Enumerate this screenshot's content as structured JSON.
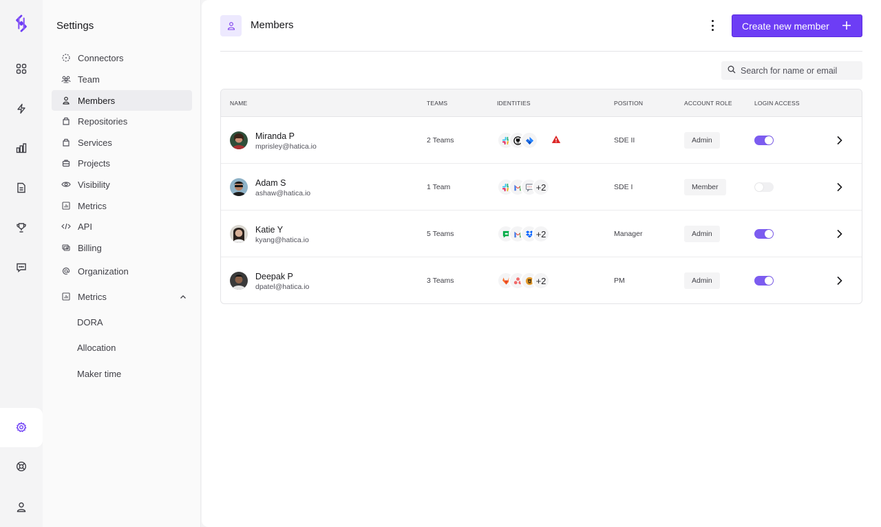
{
  "settings": {
    "title": "Settings",
    "nav": [
      {
        "label": "Connectors",
        "icon": "connectors-icon"
      },
      {
        "label": "Team",
        "icon": "team-icon"
      },
      {
        "label": "Members",
        "icon": "user-icon",
        "active": true
      },
      {
        "label": "Repositories",
        "icon": "repository-icon"
      },
      {
        "label": "Services",
        "icon": "services-icon"
      },
      {
        "label": "Projects",
        "icon": "briefcase-icon"
      },
      {
        "label": "Visibility",
        "icon": "eye-icon"
      },
      {
        "label": "Metrics",
        "icon": "metrics-icon"
      },
      {
        "label": "API",
        "icon": "code-icon"
      },
      {
        "label": "Billing",
        "icon": "billing-icon"
      },
      {
        "label": "Organization",
        "icon": "at-icon"
      },
      {
        "label": "Metrics",
        "icon": "metrics-icon",
        "expanded": true
      }
    ],
    "sub_nav": [
      "DORA",
      "Allocation",
      "Maker time"
    ]
  },
  "header": {
    "title": "Members",
    "create_label": "Create new member"
  },
  "search": {
    "placeholder": "Search for name or email"
  },
  "table": {
    "columns": [
      "NAME",
      "TEAMS",
      "IDENTITIES",
      "POSITION",
      "ACCOUNT ROLE",
      "LOGIN ACCESS"
    ],
    "rows": [
      {
        "name": "Miranda P",
        "email": "mprisley@hatica.io",
        "teams": "2 Teams",
        "identities": [
          "slack-icon",
          "github-icon",
          "jira-icon"
        ],
        "extra": "",
        "warning": true,
        "position": "SDE II",
        "role": "Admin",
        "login_access": true
      },
      {
        "name": "Adam S",
        "email": "ashaw@hatica.io",
        "teams": "1 Team",
        "identities": [
          "slack-icon",
          "gmail-icon",
          "chat-icon"
        ],
        "extra": "+2",
        "warning": false,
        "position": "SDE I",
        "role": "Member",
        "login_access": false
      },
      {
        "name": "Katie Y",
        "email": "kyang@hatica.io",
        "teams": "5 Teams",
        "identities": [
          "google-chat-icon",
          "gmail-icon",
          "dropbox-icon"
        ],
        "extra": "+2",
        "warning": false,
        "position": "Manager",
        "role": "Admin",
        "login_access": true
      },
      {
        "name": "Deepak P",
        "email": "dpatel@hatica.io",
        "teams": "3 Teams",
        "identities": [
          "gitlab-icon",
          "asana-icon",
          "bitbucket-icon"
        ],
        "extra": "+2",
        "warning": false,
        "position": "PM",
        "role": "Admin",
        "login_access": true
      }
    ]
  },
  "colors": {
    "accent": "#6d3df5",
    "toggle_on": "#7c5cf0",
    "warning": "#dc2626"
  }
}
